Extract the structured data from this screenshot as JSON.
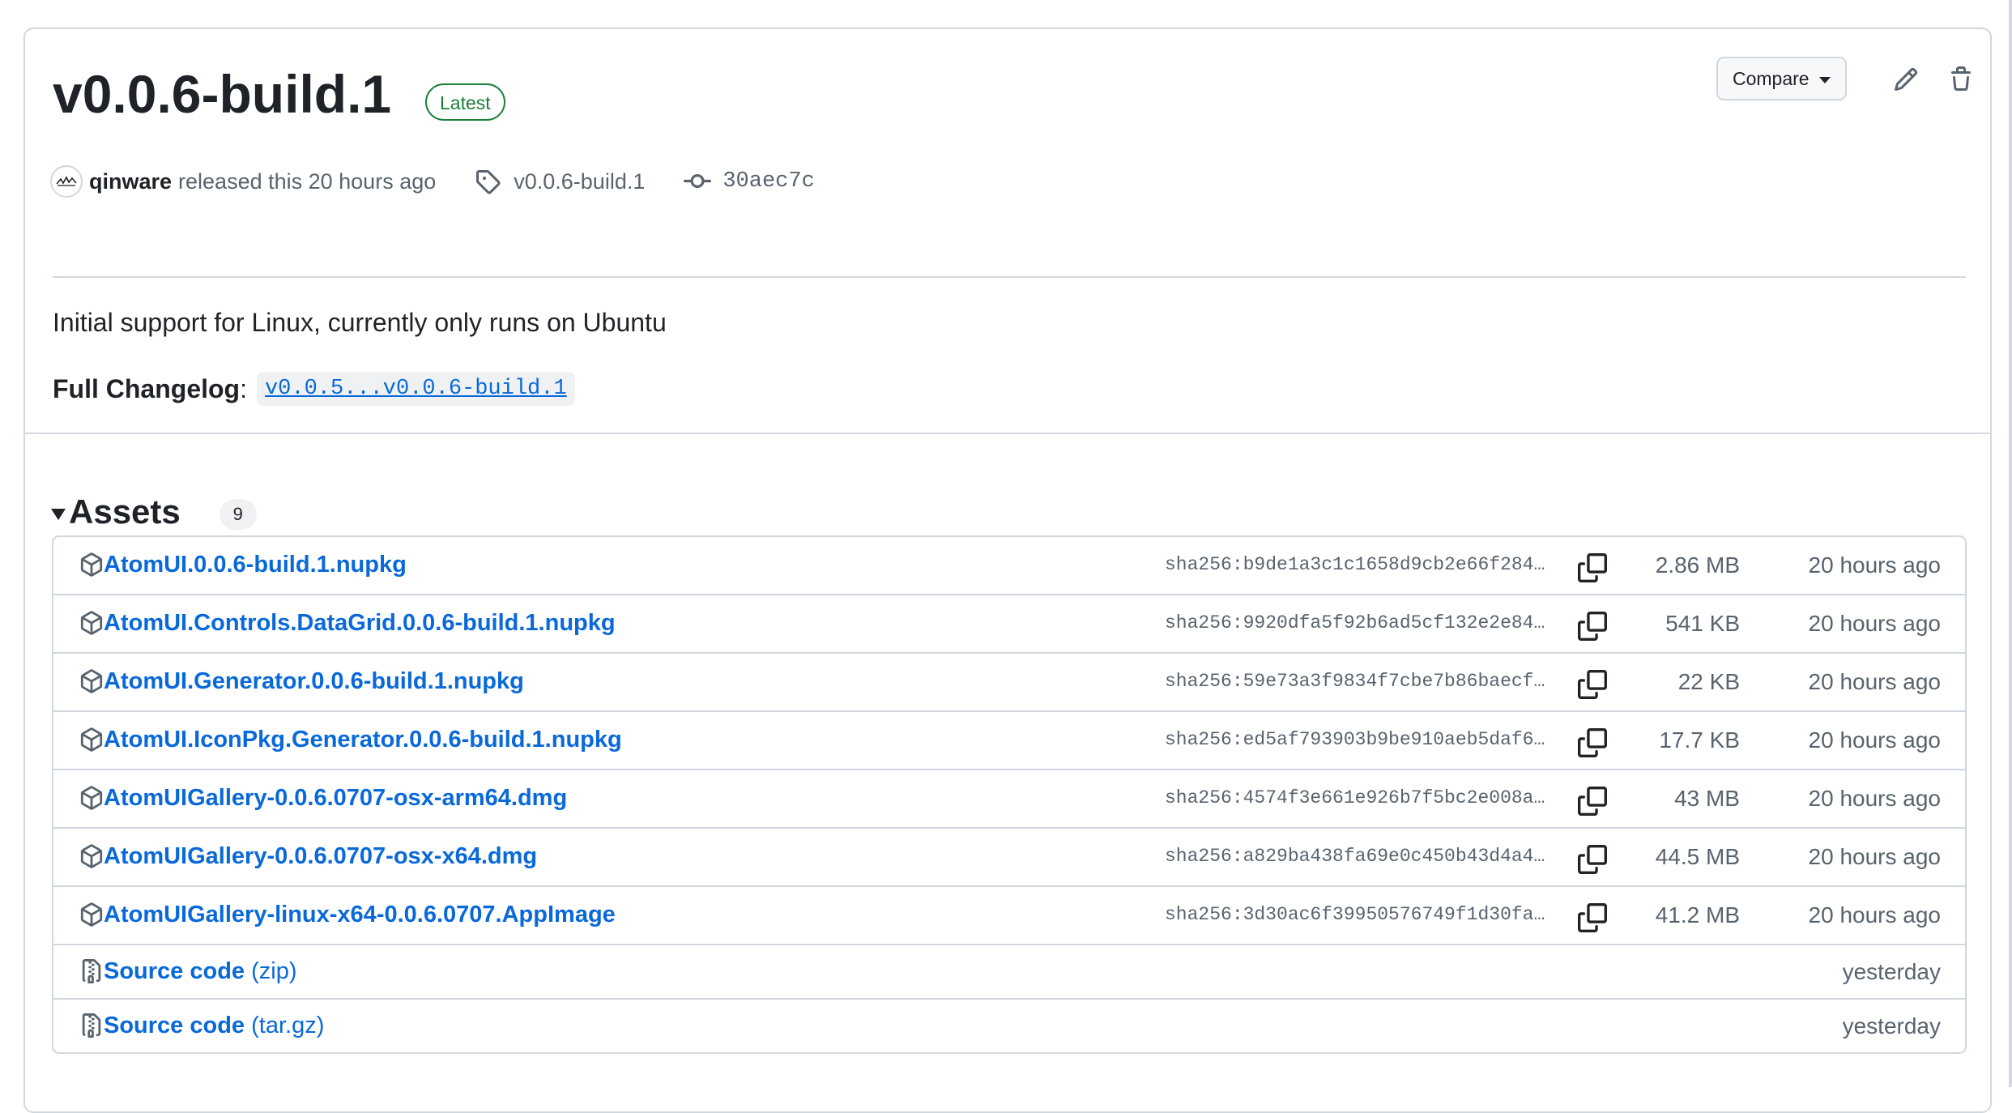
{
  "release": {
    "title": "v0.0.6-build.1",
    "badge": "Latest",
    "author": "qinware",
    "released_text": "released this 20 hours ago",
    "tag": "v0.0.6-build.1",
    "commit": "30aec7c",
    "compare_label": "Compare",
    "description": "Initial support for Linux, currently only runs on Ubuntu",
    "changelog_label": "Full Changelog",
    "changelog_colon": ":",
    "changelog_link": "v0.0.5...v0.0.6-build.1"
  },
  "assets": {
    "title": "Assets",
    "count": "9",
    "items": [
      {
        "name": "AtomUI.0.0.6-build.1.nupkg",
        "sha": "sha256:b9de1a3c1c1658d9cb2e66f284…",
        "size": "2.86 MB",
        "time": "20 hours ago",
        "icon": "package-icon"
      },
      {
        "name": "AtomUI.Controls.DataGrid.0.0.6-build.1.nupkg",
        "sha": "sha256:9920dfa5f92b6ad5cf132e2e84…",
        "size": "541 KB",
        "time": "20 hours ago",
        "icon": "package-icon"
      },
      {
        "name": "AtomUI.Generator.0.0.6-build.1.nupkg",
        "sha": "sha256:59e73a3f9834f7cbe7b86baecf…",
        "size": "22 KB",
        "time": "20 hours ago",
        "icon": "package-icon"
      },
      {
        "name": "AtomUI.IconPkg.Generator.0.0.6-build.1.nupkg",
        "sha": "sha256:ed5af793903b9be910aeb5daf6…",
        "size": "17.7 KB",
        "time": "20 hours ago",
        "icon": "package-icon"
      },
      {
        "name": "AtomUIGallery-0.0.6.0707-osx-arm64.dmg",
        "sha": "sha256:4574f3e661e926b7f5bc2e008a…",
        "size": "43 MB",
        "time": "20 hours ago",
        "icon": "package-icon"
      },
      {
        "name": "AtomUIGallery-0.0.6.0707-osx-x64.dmg",
        "sha": "sha256:a829ba438fa69e0c450b43d4a4…",
        "size": "44.5 MB",
        "time": "20 hours ago",
        "icon": "package-icon"
      },
      {
        "name": "AtomUIGallery-linux-x64-0.0.6.0707.AppImage",
        "sha": "sha256:3d30ac6f39950576749f1d30fa…",
        "size": "41.2 MB",
        "time": "20 hours ago",
        "icon": "package-icon"
      }
    ],
    "sources": [
      {
        "name": "Source code",
        "suffix": "(zip)",
        "time": "yesterday",
        "icon": "file-zip-icon"
      },
      {
        "name": "Source code",
        "suffix": "(tar.gz)",
        "time": "yesterday",
        "icon": "file-zip-icon"
      }
    ]
  },
  "colors": {
    "link": "#0969da",
    "latest_badge": "#1a7f37",
    "muted_text": "#59636e",
    "border": "#d0d7de"
  }
}
